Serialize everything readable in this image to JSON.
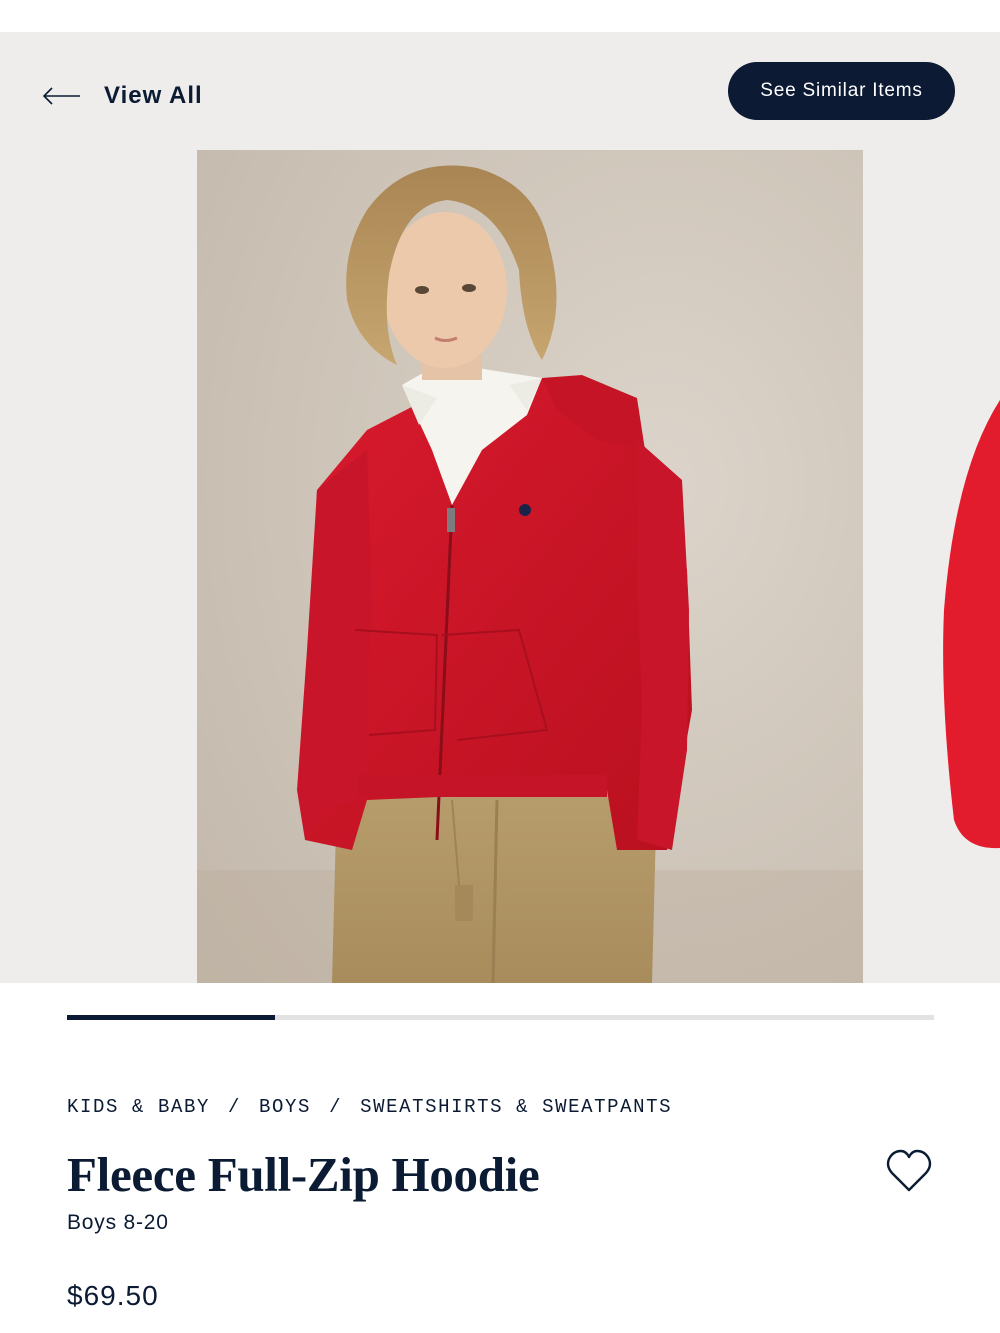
{
  "header": {
    "back_label": "View All",
    "similar_label": "See Similar Items"
  },
  "gallery": {
    "image_alt": "Boy wearing red fleece full-zip hoodie over white polo shirt and khaki pants",
    "progress_fraction": 0.24
  },
  "breadcrumb": [
    "KIDS & BABY",
    "BOYS",
    "SWEATSHIRTS & SWEATPANTS"
  ],
  "breadcrumb_separator": "/",
  "product": {
    "title": "Fleece Full-Zip Hoodie",
    "subtitle": "Boys 8-20",
    "price": "$69.50"
  },
  "colors": {
    "navy": "#0c1a33",
    "hoodie_red": "#d0182b",
    "background": "#efedeb"
  },
  "icons": {
    "back": "arrow-left-icon",
    "wishlist": "heart-outline-icon"
  }
}
